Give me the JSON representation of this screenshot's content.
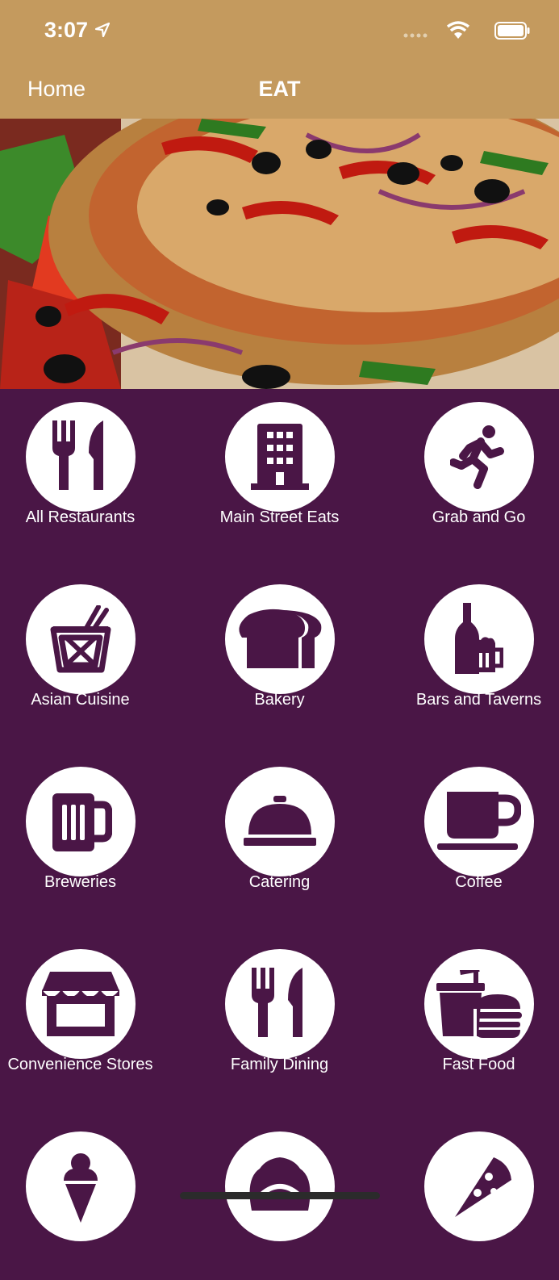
{
  "status_bar": {
    "time": "3:07"
  },
  "nav": {
    "back_label": "Home",
    "title": "EAT"
  },
  "colors": {
    "header": "#c49a5e",
    "background": "#4a1646",
    "icon": "#4a1646"
  },
  "categories": [
    {
      "label": "All Restaurants",
      "icon": "fork-knife-icon"
    },
    {
      "label": "Main Street Eats",
      "icon": "building-icon"
    },
    {
      "label": "Grab and Go",
      "icon": "running-person-icon"
    },
    {
      "label": "Asian Cuisine",
      "icon": "takeout-box-icon"
    },
    {
      "label": "Bakery",
      "icon": "bread-icon"
    },
    {
      "label": "Bars and Taverns",
      "icon": "bottle-mug-icon"
    },
    {
      "label": "Breweries",
      "icon": "beer-mug-icon"
    },
    {
      "label": "Catering",
      "icon": "cloche-icon"
    },
    {
      "label": "Coffee",
      "icon": "coffee-cup-icon"
    },
    {
      "label": "Convenience Stores",
      "icon": "storefront-icon"
    },
    {
      "label": "Family Dining",
      "icon": "fork-knife-icon"
    },
    {
      "label": "Fast Food",
      "icon": "soda-burger-icon"
    },
    {
      "label": "",
      "icon": "ice-cream-icon"
    },
    {
      "label": "",
      "icon": "pie-icon"
    },
    {
      "label": "",
      "icon": "pizza-slice-icon"
    }
  ]
}
